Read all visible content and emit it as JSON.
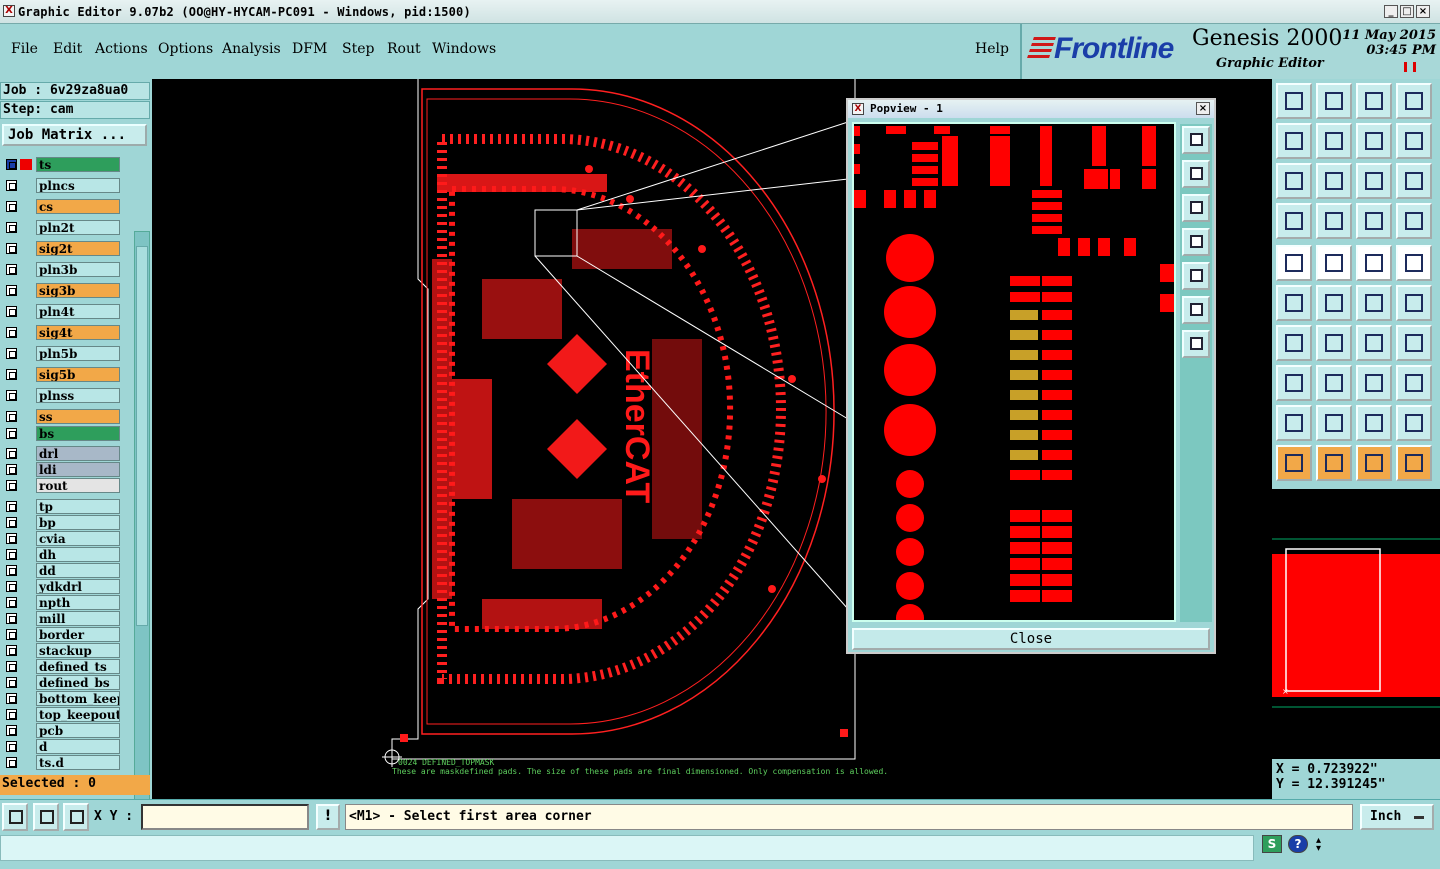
{
  "window": {
    "title": "Graphic Editor 9.07b2 (OO@HY-HYCAM-PC091 - Windows, pid:1500)"
  },
  "menu": {
    "items": [
      "File",
      "Edit",
      "Actions",
      "Options",
      "Analysis",
      "DFM",
      "Step",
      "Rout",
      "Windows"
    ],
    "help": "Help"
  },
  "brand": {
    "logo": "Frontline",
    "product": "Genesis 2000",
    "subtitle": "Graphic Editor",
    "date": "11 May 2015",
    "time": "03:45 PM"
  },
  "job": {
    "job_line": "Job : 6v29za8ua0",
    "step_line": "Step: cam",
    "matrix_button": "Job Matrix ..."
  },
  "layers": [
    {
      "name": "ts",
      "color": "#2e9e5c",
      "active": true
    },
    {
      "name": "plncs",
      "color": "#b8e6e6"
    },
    {
      "name": "cs",
      "color": "#f2a848"
    },
    {
      "name": "pln2t",
      "color": "#b8e6e6"
    },
    {
      "name": "sig2t",
      "color": "#f2a848"
    },
    {
      "name": "pln3b",
      "color": "#b8e6e6"
    },
    {
      "name": "sig3b",
      "color": "#f2a848"
    },
    {
      "name": "pln4t",
      "color": "#b8e6e6"
    },
    {
      "name": "sig4t",
      "color": "#f2a848"
    },
    {
      "name": "pln5b",
      "color": "#b8e6e6"
    },
    {
      "name": "sig5b",
      "color": "#f2a848"
    },
    {
      "name": "plnss",
      "color": "#b8e6e6"
    },
    {
      "name": "ss",
      "color": "#f2a848"
    },
    {
      "name": "bs",
      "color": "#2e9e5c"
    },
    {
      "name": "drl",
      "color": "#a8b8c8"
    },
    {
      "name": "ldi",
      "color": "#a8b8c8"
    },
    {
      "name": "rout",
      "color": "#e4e4e4"
    },
    {
      "name": "tp",
      "color": "#b8e6e6"
    },
    {
      "name": "bp",
      "color": "#b8e6e6"
    },
    {
      "name": "cvia",
      "color": "#b8e6e6"
    },
    {
      "name": "dh",
      "color": "#b8e6e6"
    },
    {
      "name": "dd",
      "color": "#b8e6e6"
    },
    {
      "name": "ydkdrl",
      "color": "#b8e6e6"
    },
    {
      "name": "npth",
      "color": "#b8e6e6"
    },
    {
      "name": "mill",
      "color": "#b8e6e6"
    },
    {
      "name": "border",
      "color": "#b8e6e6"
    },
    {
      "name": "stackup",
      "color": "#b8e6e6"
    },
    {
      "name": "defined_ts",
      "color": "#b8e6e6"
    },
    {
      "name": "defined_bs",
      "color": "#b8e6e6"
    },
    {
      "name": "bottom_keepe",
      "color": "#b8e6e6"
    },
    {
      "name": "top_keepout",
      "color": "#b8e6e6"
    },
    {
      "name": "pcb",
      "color": "#b8e6e6"
    },
    {
      "name": "d",
      "color": "#b8e6e6"
    },
    {
      "name": "ts.d",
      "color": "#b8e6e6"
    }
  ],
  "selected_text": "Selected : 0",
  "canvas": {
    "annotation_id": "0024  DEFINED_TOPMASK",
    "annotation_note": "These are maskdefined pads. The size of these pads are final dimensioned. Only compensation is allowed.",
    "board_text": "EtherCAT"
  },
  "popview": {
    "title": "Popview - 1",
    "close_label": "Close"
  },
  "coordinates": {
    "x": "X = 0.723922\"",
    "y": "Y = 12.391245\""
  },
  "bottom": {
    "xy_label": "X Y :",
    "xy_value": "",
    "prompt": "<M1> - Select first area corner",
    "units": "Inch"
  },
  "colors": {
    "accent": "#9fd6d6",
    "pad": "#ff0000",
    "gold": "#c8a028",
    "highlight": "#f2a848"
  },
  "icons": {
    "title": "x-window-icon",
    "status_s": "s-icon",
    "status_help": "question-icon"
  }
}
